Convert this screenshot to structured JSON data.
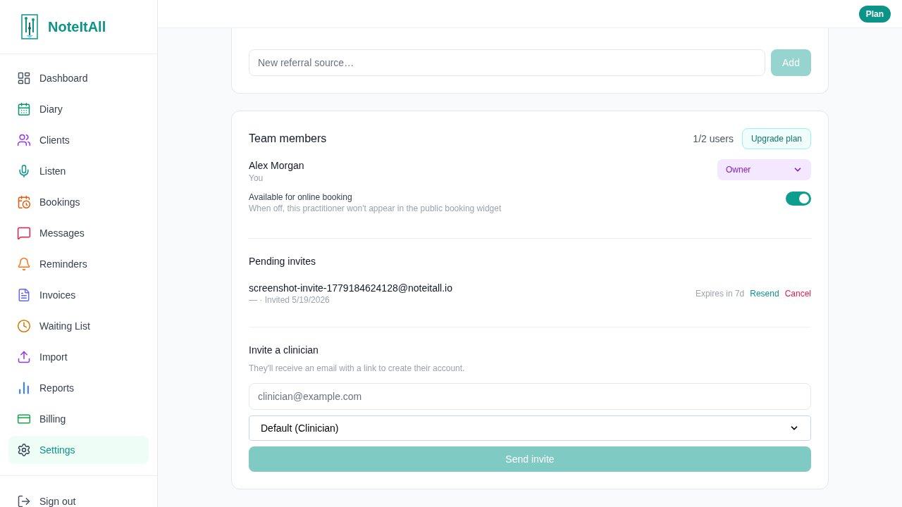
{
  "brand": {
    "name": "NoteItAll"
  },
  "nav": [
    {
      "label": "Dashboard",
      "selected": false,
      "color": "#4b5563"
    },
    {
      "label": "Diary",
      "selected": false,
      "color": "#059669"
    },
    {
      "label": "Clients",
      "selected": false,
      "color": "#9333ea"
    },
    {
      "label": "Listen",
      "selected": false,
      "color": "#0d9488"
    },
    {
      "label": "Bookings",
      "selected": false,
      "color": "#ea580c"
    },
    {
      "label": "Messages",
      "selected": false,
      "color": "#e11d48"
    },
    {
      "label": "Reminders",
      "selected": false,
      "color": "#f97316"
    },
    {
      "label": "Invoices",
      "selected": false,
      "color": "#6366f1"
    },
    {
      "label": "Waiting List",
      "selected": false,
      "color": "#d97706"
    },
    {
      "label": "Import",
      "selected": false,
      "color": "#9333ea"
    },
    {
      "label": "Reports",
      "selected": false,
      "color": "#3b82f6"
    },
    {
      "label": "Billing",
      "selected": false,
      "color": "#16a34a"
    },
    {
      "label": "Settings",
      "selected": true,
      "color": "#374151"
    }
  ],
  "sign_out": "Sign out",
  "header": {
    "plan_button": "Plan"
  },
  "referral": {
    "placeholder": "New referral source…",
    "add_button": "Add",
    "add_disabled": true
  },
  "team": {
    "title": "Team members",
    "count": "1/2 users",
    "upgrade_button": "Upgrade plan",
    "members": [
      {
        "name": "Alex Morgan",
        "subtitle": "You",
        "role": "Owner",
        "booking_label": "Available for online booking",
        "booking_hint": "When off, this practitioner won't appear in the public booking widget",
        "online_booking": true
      }
    ],
    "pending_title": "Pending invites",
    "invites": [
      {
        "email": "screenshot-invite-1779184624128@noteitall.io",
        "meta": "— · Invited 5/19/2026",
        "expires": "Expires in 7d",
        "resend": "Resend",
        "cancel": "Cancel"
      }
    ],
    "invite": {
      "title": "Invite a clinician",
      "hint": "They'll receive an email with a link to create their account.",
      "placeholder": "clinician@example.com",
      "role": "Default (Clinician)",
      "send_button": "Send invite",
      "send_disabled": true
    }
  }
}
